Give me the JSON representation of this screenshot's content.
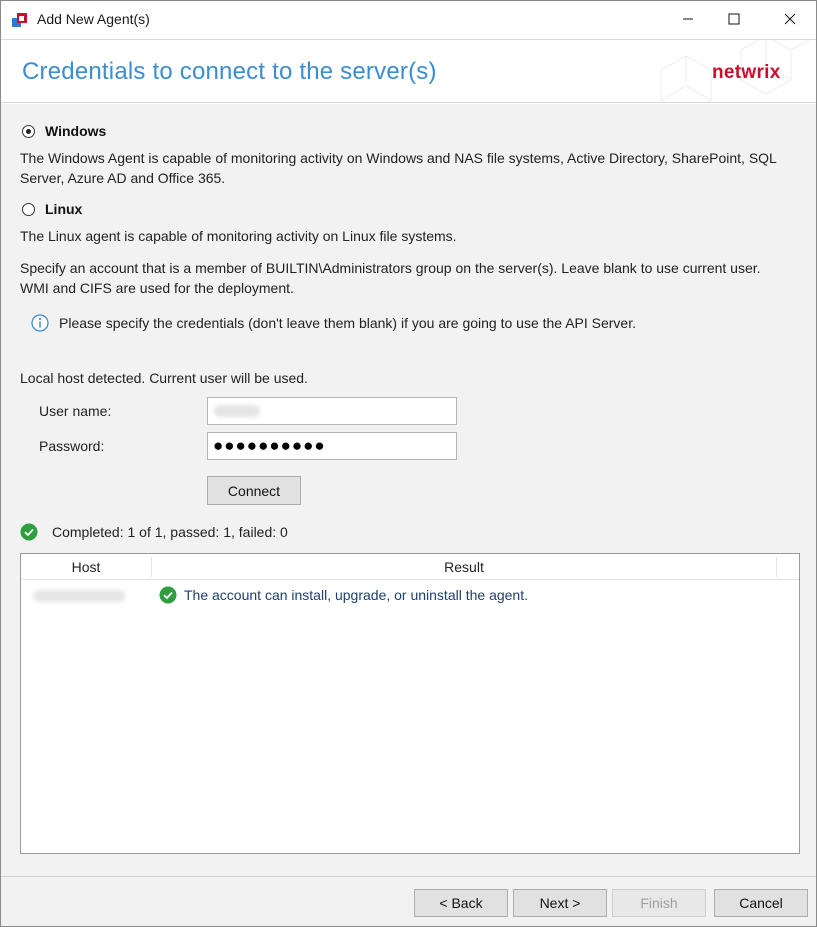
{
  "window": {
    "title": "Add New Agent(s)",
    "icons": {
      "app": "netwrix-app-icon",
      "minimize": "minimize-icon",
      "maximize": "maximize-icon",
      "close": "close-icon"
    }
  },
  "header": {
    "title": "Credentials to connect to the server(s)",
    "logo_text": "netwrix",
    "title_color": "#3c8dd0",
    "logo_color": "#c8102e"
  },
  "agent_type": {
    "windows": {
      "label": "Windows",
      "selected": true,
      "description": "The Windows Agent is capable of monitoring activity on Windows and NAS file systems, Active Directory, SharePoint, SQL Server, Azure AD and Office 365."
    },
    "linux": {
      "label": "Linux",
      "selected": false,
      "description": "The Linux agent is capable of monitoring activity on Linux file systems."
    }
  },
  "account_instructions": "Specify an account that is a member of BUILTIN\\Administrators group on the server(s). Leave blank to use current user. WMI and CIFS are used for the deployment.",
  "info_note": {
    "icon": "info-icon",
    "text": "Please specify the credentials (don't leave them blank) if you are going to use the API Server."
  },
  "credentials": {
    "local_host_message": "Local host detected. Current user will be used.",
    "username_label": "User name:",
    "username_value": "",
    "password_label": "Password:",
    "password_masked": "●●●●●●●●●●",
    "connect_label": "Connect"
  },
  "status": {
    "icon": "check-circle-icon",
    "text": "Completed: 1 of 1, passed: 1, failed: 0",
    "success_color": "#2e9e3e"
  },
  "results_table": {
    "columns": [
      "Host",
      "Result"
    ],
    "rows": [
      {
        "host": "",
        "result_icon": "check-circle-icon",
        "result": "The account can install, upgrade, or uninstall the agent."
      }
    ]
  },
  "footer": {
    "back_label": "< Back",
    "next_label": "Next >",
    "finish_label": "Finish",
    "cancel_label": "Cancel",
    "finish_enabled": false
  }
}
